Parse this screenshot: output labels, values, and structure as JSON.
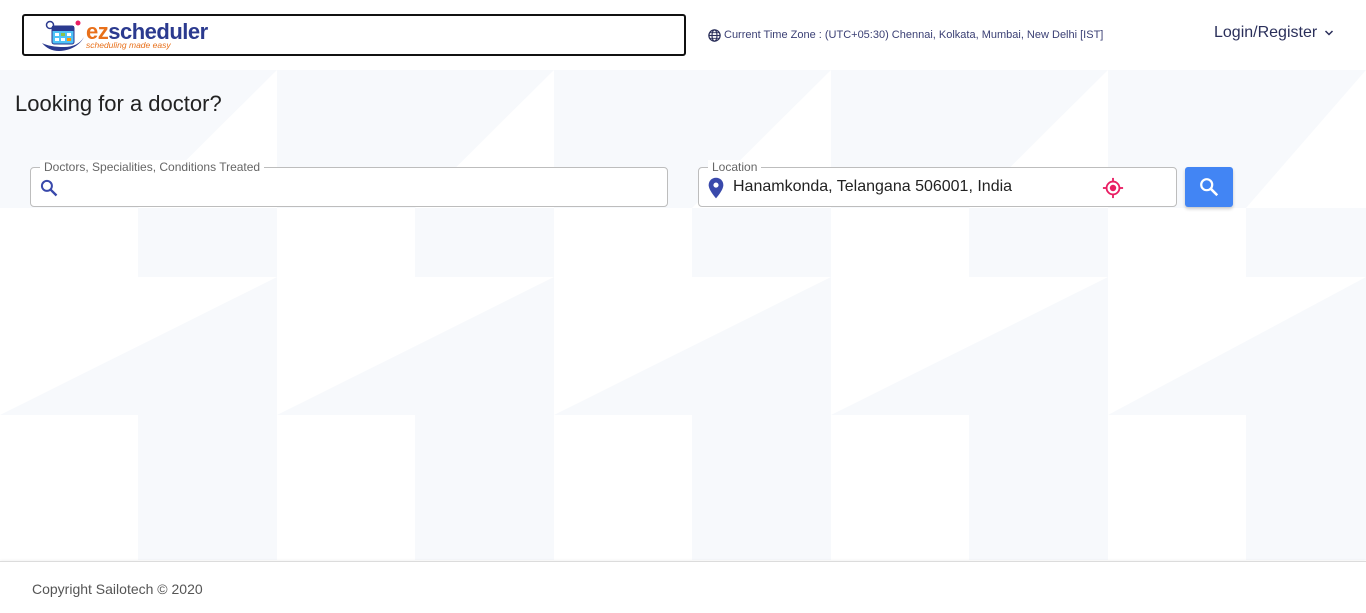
{
  "header": {
    "logo_ez": "ez",
    "logo_scheduler": "scheduler",
    "logo_tagline": "scheduling made easy",
    "timezone_text": "Current Time Zone : (UTC+05:30) Chennai, Kolkata, Mumbai, New Delhi [IST]",
    "login_label": "Login/Register"
  },
  "main": {
    "title": "Looking for a doctor?",
    "search_field": {
      "label": "Doctors, Specialities, Conditions Treated",
      "value": "",
      "icon": "search-icon"
    },
    "location_field": {
      "label": "Location",
      "value": "Hanamkonda, Telangana 506001, India",
      "icon": "location-pin-icon",
      "locate_icon": "crosshair-icon"
    },
    "search_button_icon": "search-icon"
  },
  "footer": {
    "copyright": "Copyright Sailotech © 2020"
  },
  "colors": {
    "accent_blue": "#4285f4",
    "brand_navy": "#2b3a8f",
    "brand_orange": "#e8701a",
    "locate_pink": "#e91e63",
    "pin_navy": "#3949ab"
  }
}
